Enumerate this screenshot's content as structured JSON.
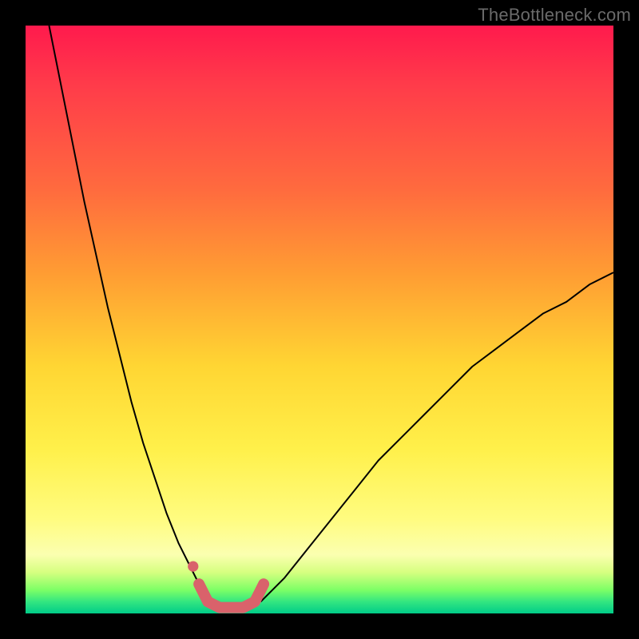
{
  "watermark": "TheBottleneck.com",
  "chart_data": {
    "type": "line",
    "title": "",
    "xlabel": "",
    "ylabel": "",
    "xlim": [
      0,
      100
    ],
    "ylim": [
      0,
      100
    ],
    "grid": false,
    "legend": false,
    "background_gradient_stops": [
      {
        "pos": 0,
        "color": "#ff1a4d"
      },
      {
        "pos": 28,
        "color": "#ff6b3e"
      },
      {
        "pos": 58,
        "color": "#ffd633"
      },
      {
        "pos": 84,
        "color": "#fffc80"
      },
      {
        "pos": 96,
        "color": "#7dff66"
      },
      {
        "pos": 100,
        "color": "#00cc88"
      }
    ],
    "series": [
      {
        "name": "left-branch",
        "stroke": "#000000",
        "stroke_width": 2,
        "x": [
          4,
          6,
          8,
          10,
          12,
          14,
          16,
          18,
          20,
          22,
          24,
          26,
          28,
          30,
          31
        ],
        "y": [
          100,
          90,
          80,
          70,
          61,
          52,
          44,
          36,
          29,
          23,
          17,
          12,
          8,
          4,
          2
        ]
      },
      {
        "name": "right-branch",
        "stroke": "#000000",
        "stroke_width": 2,
        "x": [
          40,
          44,
          48,
          52,
          56,
          60,
          64,
          68,
          72,
          76,
          80,
          84,
          88,
          92,
          96,
          100
        ],
        "y": [
          2,
          6,
          11,
          16,
          21,
          26,
          30,
          34,
          38,
          42,
          45,
          48,
          51,
          53,
          56,
          58
        ]
      },
      {
        "name": "valley-marker",
        "stroke": "#d9626b",
        "stroke_width": 14,
        "linecap": "round",
        "x": [
          29.5,
          31,
          33,
          35,
          37,
          39,
          40.5
        ],
        "y": [
          5,
          2,
          1,
          1,
          1,
          2,
          5
        ]
      },
      {
        "name": "valley-dot",
        "type_hint": "scatter",
        "stroke": "#d9626b",
        "fill": "#d9626b",
        "radius": 5,
        "x": [
          28.5
        ],
        "y": [
          8
        ]
      }
    ]
  }
}
